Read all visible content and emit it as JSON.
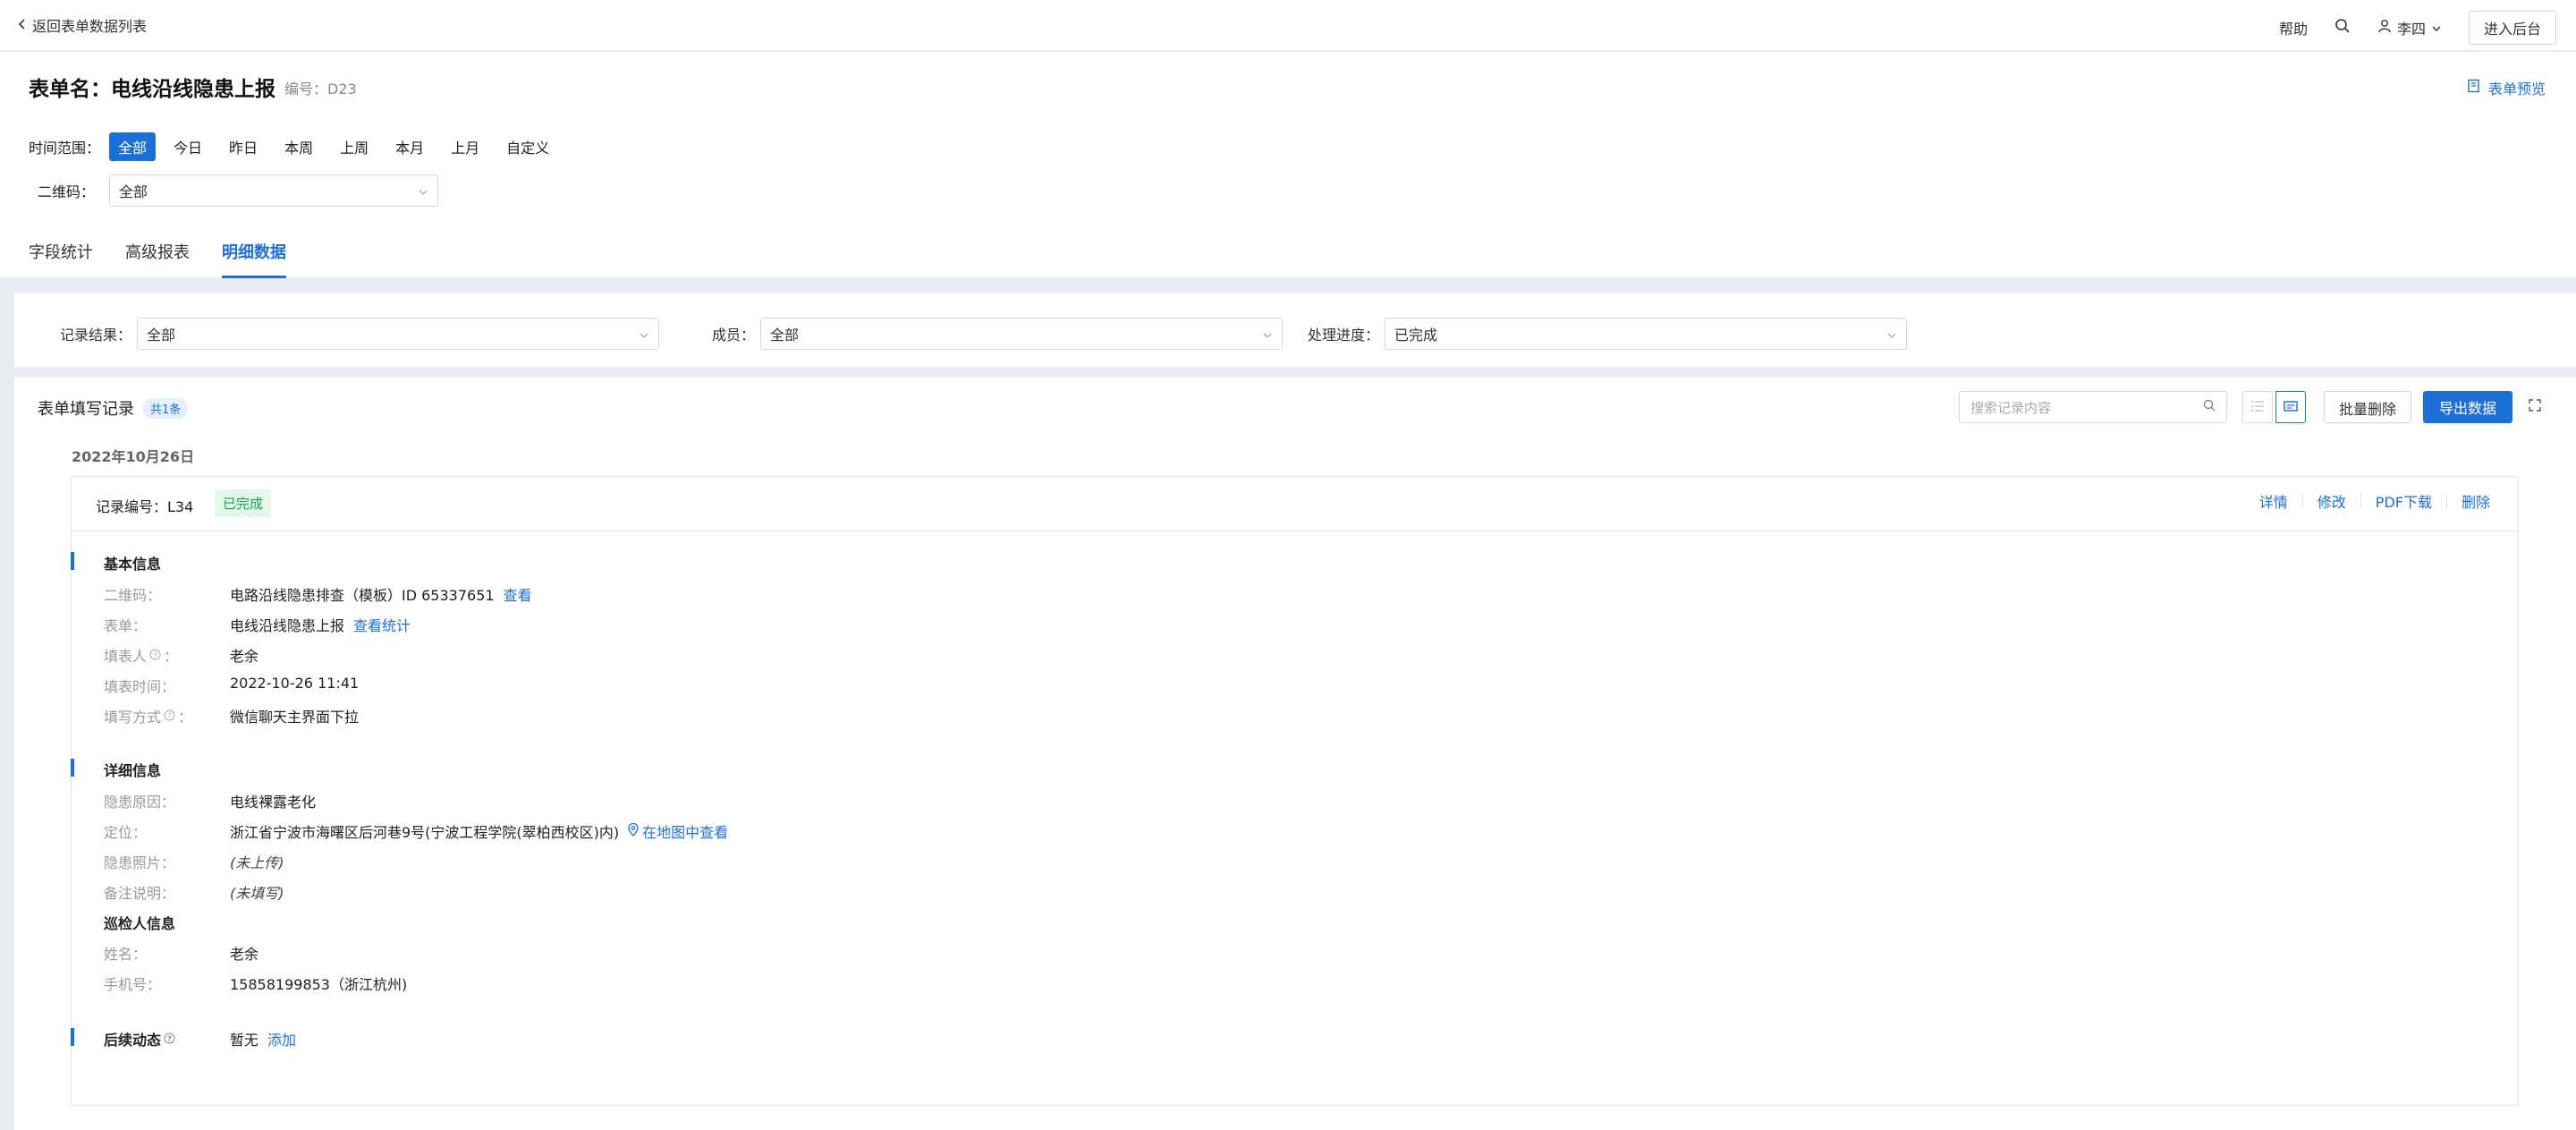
{
  "topbar": {
    "back_label": "返回表单数据列表",
    "help": "帮助",
    "user_name": "李四",
    "enter_admin": "进入后台"
  },
  "header": {
    "title": "表单名：电线沿线隐患上报",
    "code": "编号：D23",
    "preview": "表单预览",
    "time_label": "时间范围：",
    "time_options": [
      "全部",
      "今日",
      "昨日",
      "本周",
      "上周",
      "本月",
      "上月",
      "自定义"
    ],
    "qr_label": "二维码：",
    "qr_value": "全部",
    "tabs": [
      "字段统计",
      "高级报表",
      "明细数据"
    ]
  },
  "filters": {
    "result_label": "记录结果：",
    "result_value": "全部",
    "member_label": "成员：",
    "member_value": "全部",
    "progress_label": "处理进度：",
    "progress_value": "已完成"
  },
  "records": {
    "title": "表单填写记录",
    "count": "共1条",
    "search_placeholder": "搜索记录内容",
    "batch_delete": "批量删除",
    "export": "导出数据",
    "date": "2022年10月26日"
  },
  "record": {
    "number": "记录编号：L34",
    "status": "已完成",
    "actions": [
      "详情",
      "修改",
      "PDF下载",
      "删除"
    ],
    "basic_title": "基本信息",
    "basic": {
      "qr_label": "二维码：",
      "qr_value": "电路沿线隐患排查（模板）ID 65337651",
      "qr_link": "查看",
      "form_label": "表单：",
      "form_value": "电线沿线隐患上报",
      "form_link": "查看统计",
      "filler_label": "填表人",
      "filler_value": "老余",
      "time_label": "填表时间：",
      "time_value": "2022-10-26 11:41",
      "method_label": "填写方式",
      "method_value": "微信聊天主界面下拉"
    },
    "detail_title": "详细信息",
    "detail": {
      "cause_label": "隐患原因：",
      "cause_value": "电线裸露老化",
      "loc_label": "定位：",
      "loc_value": "浙江省宁波市海曙区后河巷9号(宁波工程学院(翠柏西校区)内)",
      "loc_link": "在地图中查看",
      "photo_label": "隐患照片：",
      "photo_value": "(未上传)",
      "note_label": "备注说明：",
      "note_value": "(未填写)",
      "inspector_title": "巡检人信息",
      "name_label": "姓名：",
      "name_value": "老余",
      "phone_label": "手机号：",
      "phone_value": "15858199853（浙江杭州)"
    },
    "followup_title": "后续动态",
    "followup_value": "暂无",
    "followup_link": "添加"
  },
  "colors": {
    "accent": "#1d6fd8",
    "success": "#17a34a",
    "background": "#e9edf2"
  }
}
